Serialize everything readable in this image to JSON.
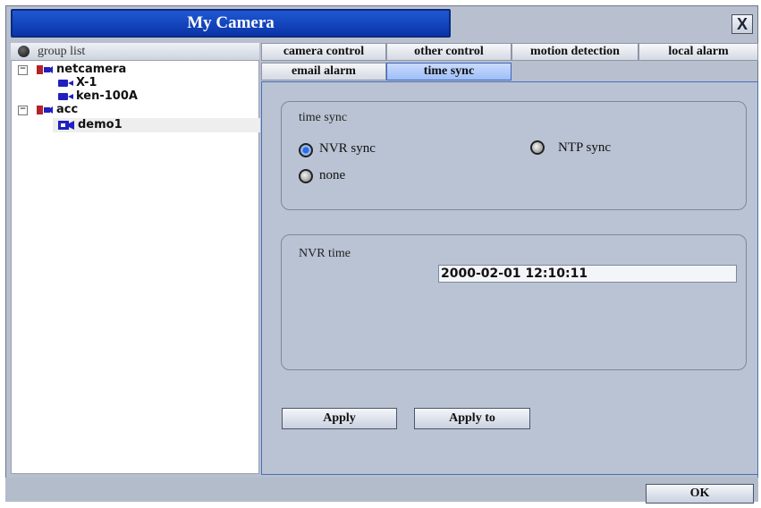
{
  "window": {
    "title": "My Camera",
    "close_label": "X"
  },
  "tree": {
    "header": "group list",
    "groups": [
      {
        "name": "netcamera",
        "expander": "−",
        "children": [
          "X-1",
          "ken-100A"
        ]
      },
      {
        "name": "acc",
        "expander": "−",
        "children": [
          "demo1"
        ]
      }
    ]
  },
  "tabs": {
    "row1": [
      "camera control",
      "other control",
      "motion detection",
      "local alarm"
    ],
    "row2": [
      "email alarm",
      "time sync"
    ],
    "active": "time sync"
  },
  "time_sync": {
    "group_label": "time sync",
    "options": [
      {
        "label": "NVR sync",
        "selected": true
      },
      {
        "label": "NTP sync",
        "selected": false
      },
      {
        "label": "none",
        "selected": false
      }
    ]
  },
  "nvr_time": {
    "label": "NVR time",
    "value": "2000-02-01 12:10:11"
  },
  "buttons": {
    "apply": "Apply",
    "apply_to": "Apply to",
    "ok": "OK"
  }
}
